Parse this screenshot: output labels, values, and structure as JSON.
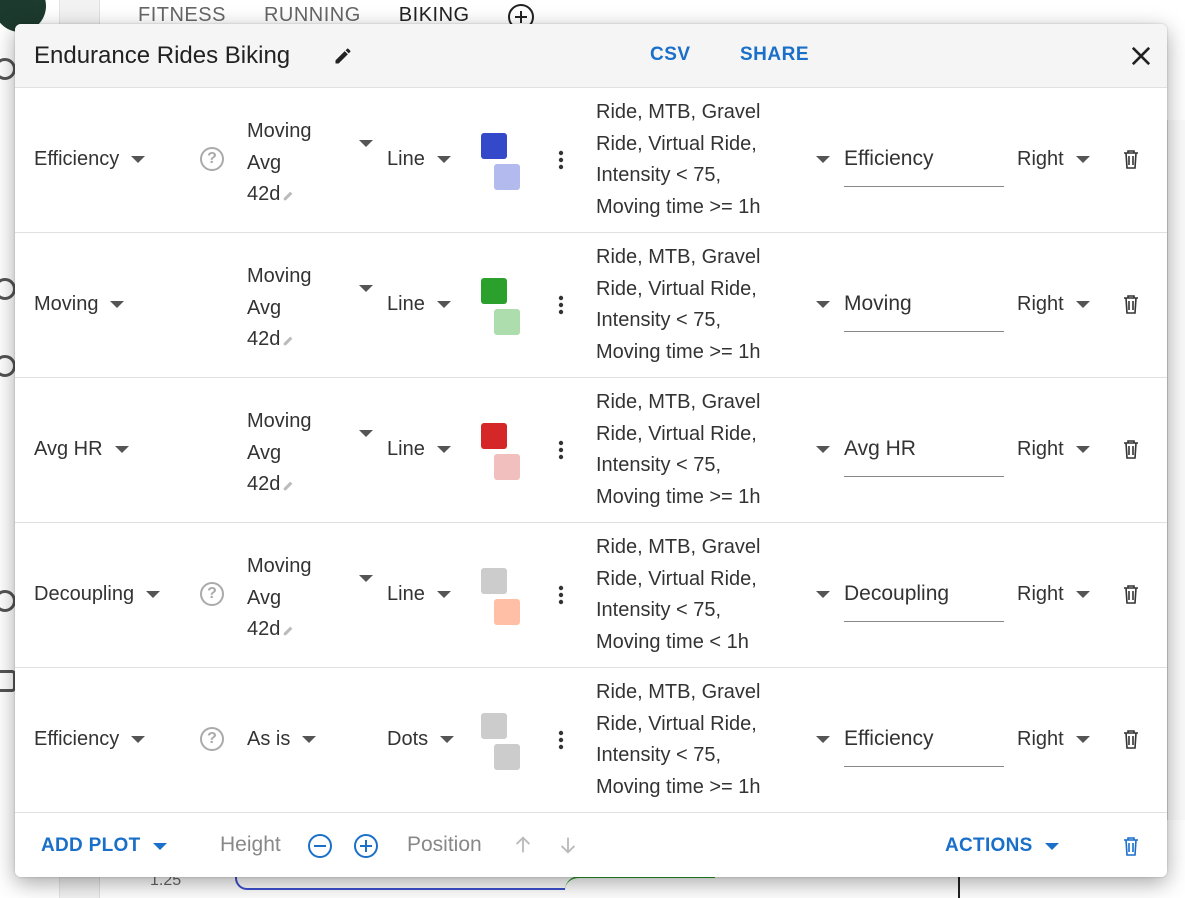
{
  "background": {
    "tabs": [
      "FITNESS",
      "RUNNING",
      "BIKING"
    ],
    "active_tab": "BIKING",
    "tick_label": "1.25"
  },
  "dialog": {
    "title": "Endurance Rides Biking",
    "csv_label": "CSV",
    "share_label": "SHARE",
    "rows": [
      {
        "metric": "Efficiency",
        "help": true,
        "smooth": [
          "Moving",
          "Avg",
          "42d"
        ],
        "smooth_editable": true,
        "type": "Line",
        "color1": "#3349c9",
        "color2": "#b3bbee",
        "filter": [
          "Ride, MTB, Gravel",
          "Ride, Virtual Ride,",
          "Intensity < 75,",
          "Moving time >= 1h"
        ],
        "label": "Efficiency",
        "side": "Right"
      },
      {
        "metric": "Moving",
        "help": false,
        "smooth": [
          "Moving",
          "Avg",
          "42d"
        ],
        "smooth_editable": true,
        "type": "Line",
        "color1": "#2ca02c",
        "color2": "#addcad",
        "filter": [
          "Ride, MTB, Gravel",
          "Ride, Virtual Ride,",
          "Intensity < 75,",
          "Moving time >= 1h"
        ],
        "label": "Moving",
        "side": "Right"
      },
      {
        "metric": "Avg HR",
        "help": false,
        "smooth": [
          "Moving",
          "Avg",
          "42d"
        ],
        "smooth_editable": true,
        "type": "Line",
        "color1": "#d62728",
        "color2": "#f2bfbf",
        "filter": [
          "Ride, MTB, Gravel",
          "Ride, Virtual Ride,",
          "Intensity < 75,",
          "Moving time >= 1h"
        ],
        "label": "Avg HR",
        "side": "Right"
      },
      {
        "metric": "Decoupling",
        "help": true,
        "smooth": [
          "Moving",
          "Avg",
          "42d"
        ],
        "smooth_editable": true,
        "type": "Line",
        "color1": "#cccccc",
        "color2": "#ffbfa6",
        "filter": [
          "Ride, MTB, Gravel",
          "Ride, Virtual Ride,",
          "Intensity < 75,",
          "Moving time < 1h"
        ],
        "label": "Decoupling",
        "side": "Right"
      },
      {
        "metric": "Efficiency",
        "help": true,
        "smooth": [
          "As is"
        ],
        "smooth_editable": false,
        "type": "Dots",
        "color1": "#cccccc",
        "color2": "#cccccc",
        "filter": [
          "Ride, MTB, Gravel",
          "Ride, Virtual Ride,",
          "Intensity < 75,",
          "Moving time >= 1h"
        ],
        "label": "Efficiency",
        "side": "Right"
      }
    ],
    "footer": {
      "add_plot_label": "ADD PLOT",
      "height_label": "Height",
      "position_label": "Position",
      "actions_label": "ACTIONS"
    }
  },
  "colors": {
    "accent": "#1a6fc9"
  }
}
